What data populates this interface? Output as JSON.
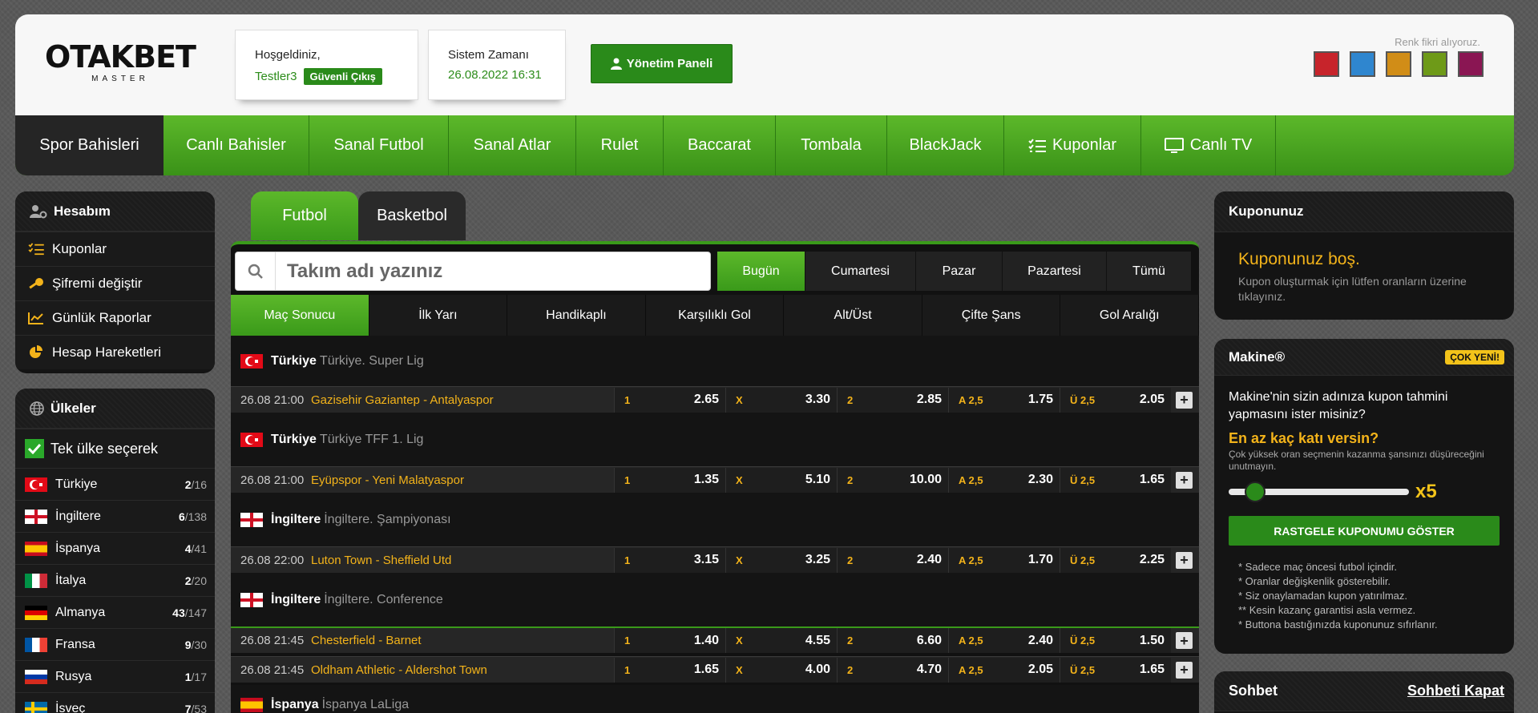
{
  "brand": {
    "name": "OTAKBET",
    "sub": "MASTER"
  },
  "welcome": {
    "title": "Hoşgeldiniz,",
    "user": "Testler3",
    "logout": "Güvenli Çıkış"
  },
  "system": {
    "title": "Sistem Zamanı",
    "time": "26.08.2022 16:31"
  },
  "admin_label": "Yönetim Paneli",
  "color_prompt": "Renk fikri alıyoruz.",
  "swatches": [
    "#c7242b",
    "#2f86cf",
    "#d18d17",
    "#6e9a18",
    "#8a1653"
  ],
  "nav": [
    "Spor Bahisleri",
    "Canlı Bahisler",
    "Sanal Futbol",
    "Sanal Atlar",
    "Rulet",
    "Baccarat",
    "Tombala",
    "BlackJack",
    "Kuponlar",
    "Canlı TV"
  ],
  "account": {
    "title": "Hesabım",
    "items": [
      "Kuponlar",
      "Şifremi değiştir",
      "Günlük Raporlar",
      "Hesap Hareketleri"
    ]
  },
  "countries": {
    "title": "Ülkeler",
    "single": "Tek ülke seçerek",
    "items": [
      {
        "name": "Türkiye",
        "a": "2",
        "b": "/16"
      },
      {
        "name": "İngiltere",
        "a": "6",
        "b": "/138"
      },
      {
        "name": "İspanya",
        "a": "4",
        "b": "/41"
      },
      {
        "name": "İtalya",
        "a": "2",
        "b": "/20"
      },
      {
        "name": "Almanya",
        "a": "43",
        "b": "/147"
      },
      {
        "name": "Fransa",
        "a": "9",
        "b": "/30"
      },
      {
        "name": "Rusya",
        "a": "1",
        "b": "/17"
      },
      {
        "name": "İsveç",
        "a": "7",
        "b": "/53"
      }
    ]
  },
  "sport_tabs": [
    "Futbol",
    "Basketbol"
  ],
  "search": {
    "placeholder": "Takım adı yazınız"
  },
  "days": [
    "Bugün",
    "Cumartesi",
    "Pazar",
    "Pazartesi",
    "Tümü"
  ],
  "markets": [
    "Maç Sonucu",
    "İlk Yarı",
    "Handikaplı",
    "Karşılıklı Gol",
    "Alt/Üst",
    "Çifte Şans",
    "Gol Aralığı"
  ],
  "leagues": [
    {
      "country": "Türkiye",
      "name": "Türkiye. Super Lig",
      "matches": [
        {
          "time": "26.08 21:00",
          "teams": "Gazisehir Gaziantep - Antalyaspor",
          "o": [
            "2.65",
            "3.30",
            "2.85",
            "1.75",
            "2.05"
          ]
        }
      ]
    },
    {
      "country": "Türkiye",
      "name": "Türkiye TFF 1. Lig",
      "matches": [
        {
          "time": "26.08 21:00",
          "teams": "Eyüpspor - Yeni Malatyaspor",
          "o": [
            "1.35",
            "5.10",
            "10.00",
            "2.30",
            "1.65"
          ]
        }
      ]
    },
    {
      "country": "İngiltere",
      "name": "İngiltere. Şampiyonası",
      "matches": [
        {
          "time": "26.08 22:00",
          "teams": "Luton Town - Sheffield Utd",
          "o": [
            "3.15",
            "3.25",
            "2.40",
            "1.70",
            "2.25"
          ]
        }
      ]
    },
    {
      "country": "İngiltere",
      "name": "İngiltere. Conference",
      "matches": [
        {
          "time": "26.08 21:45",
          "teams": "Chesterfield - Barnet",
          "o": [
            "1.40",
            "4.55",
            "6.60",
            "2.40",
            "1.50"
          ]
        },
        {
          "time": "26.08 21:45",
          "teams": "Oldham Athletic - Aldershot Town",
          "o": [
            "1.65",
            "4.00",
            "4.70",
            "2.05",
            "1.65"
          ]
        }
      ]
    },
    {
      "country": "İspanya",
      "name": "İspanya LaLiga",
      "matches": []
    }
  ],
  "odd_keys": [
    "1",
    "X",
    "2",
    "A 2,5",
    "Ü 2,5"
  ],
  "coupon": {
    "title": "Kuponunuz",
    "empty": "Kuponunuz boş.",
    "hint": "Kupon oluşturmak için lütfen oranların üzerine tıklayınız."
  },
  "machine": {
    "title": "Makine®",
    "badge": "ÇOK YENİ!",
    "question": "Makine'nin sizin adınıza kupon tahmini yapmasını ister misiniz?",
    "min": "En az kaç katı versin?",
    "warn": "Çok yüksek oran seçmenin kazanma şansınızı düşüreceğini unutmayın.",
    "mult": "x5",
    "slider_fraction": 0.1,
    "button": "RASTGELE KUPONUMU GÖSTER",
    "notes": [
      "* Sadece maç öncesi futbol içindir.",
      "* Oranlar değişkenlik gösterebilir.",
      "* Siz onaylamadan kupon yatırılmaz.",
      "** Kesin kazanç garantisi asla vermez.",
      "* Buttona bastığınızda kuponunuz sıfırlanır."
    ]
  },
  "chat": {
    "title": "Sohbet",
    "close": "Sohbeti Kapat"
  }
}
